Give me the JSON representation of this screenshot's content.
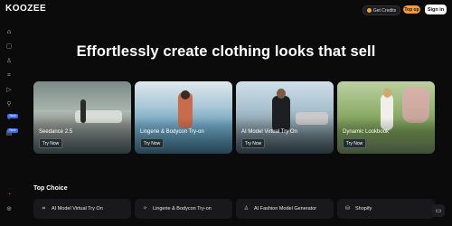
{
  "header": {
    "logo": "KOOZEE",
    "get_credits": "Get Credits",
    "top_up": "Top up",
    "sign_in": "Sign in"
  },
  "sidebar": {
    "badges": [
      "New",
      "New"
    ]
  },
  "hero": {
    "title": "Effortlessly create clothing looks that sell"
  },
  "cards": [
    {
      "title": "Seedance 2.5",
      "cta": "Try Now"
    },
    {
      "title": "Lingerie & Bodycon Try-on",
      "cta": "Try Now"
    },
    {
      "title": "AI Model Virtual Try On",
      "cta": "Try Now"
    },
    {
      "title": "Dynamic Lookbook",
      "cta": "Try Now"
    }
  ],
  "section": {
    "title": "Top Choice"
  },
  "choices": [
    {
      "label": "AI Model Virtual Try On",
      "icon": "shirt-icon"
    },
    {
      "label": "Lingerie & Bodycon Try-on",
      "icon": "sparkle-icon"
    },
    {
      "label": "AI Fashion Model Generator",
      "icon": "person-icon"
    },
    {
      "label": "Shopify",
      "icon": "shopify-icon"
    }
  ],
  "colors": {
    "background": "#0b0b0c",
    "top_up": "#f79b3c",
    "badge": "#3a6df0"
  }
}
